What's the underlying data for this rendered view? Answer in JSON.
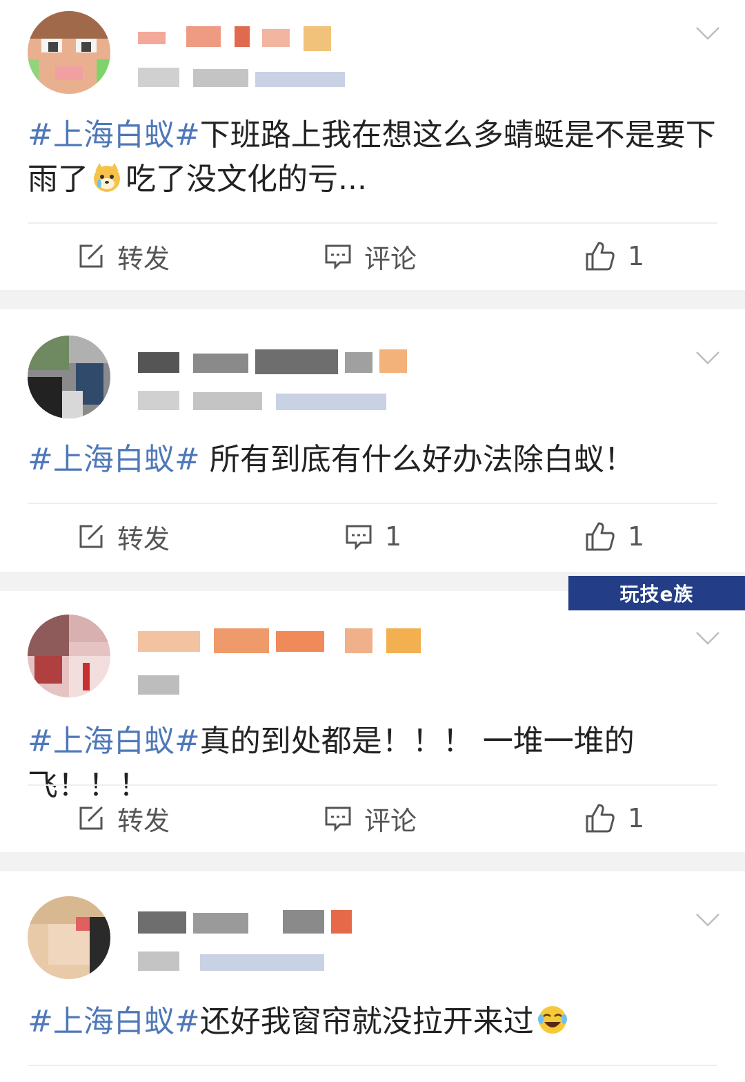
{
  "posts": [
    {
      "content_tag": "#上海白蚁#",
      "content_pre": "下班路上我在想这么多蜻蜓是不是要下雨了",
      "content_post": "吃了没文化的亏...",
      "emoji": "dog-crying-emoji",
      "actions": {
        "repost": "转发",
        "comment": "评论",
        "like": "1"
      }
    },
    {
      "content_tag": "#上海白蚁#",
      "content_pre": " 所有到底有什么好办法除白蚁！",
      "content_post": "",
      "actions": {
        "repost": "转发",
        "comment": "1",
        "like": "1"
      }
    },
    {
      "content_tag": "#上海白蚁#",
      "content_pre": "真的到处都是！！！ 一堆一堆的飞！！！",
      "content_post": "",
      "actions": {
        "repost": "转发",
        "comment": "评论",
        "like": "1"
      }
    },
    {
      "content_tag": "#上海白蚁#",
      "content_pre": "还好我窗帘就没拉开来过",
      "content_post": "",
      "emoji": "laughing-crying-emoji",
      "actions": {}
    }
  ],
  "watermark": "玩技e族",
  "colors": {
    "hashtag": "#4f78b8",
    "divider": "#eeeeee",
    "gap": "#f2f2f2"
  }
}
